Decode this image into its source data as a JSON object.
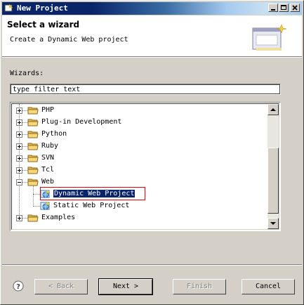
{
  "window": {
    "title": "New Project",
    "colors": {
      "titlebar": "#0a246a",
      "face": "#d4d0c8",
      "selection": "#0a246a",
      "highlight_box": "#e00000"
    }
  },
  "header": {
    "title": "Select a wizard",
    "description": "Create a Dynamic Web project",
    "banner_icon": "wizard-banner-icon"
  },
  "wizards": {
    "label": "Wizards:",
    "filter_value": "type filter text"
  },
  "tree": {
    "items": [
      {
        "label": "PHP",
        "expanded": false
      },
      {
        "label": "Plug-in Development",
        "expanded": false
      },
      {
        "label": "Python",
        "expanded": false
      },
      {
        "label": "Ruby",
        "expanded": false
      },
      {
        "label": "SVN",
        "expanded": false
      },
      {
        "label": "Tcl",
        "expanded": false
      },
      {
        "label": "Web",
        "expanded": true
      },
      {
        "label": "Dynamic Web Project",
        "child": true,
        "selected": true
      },
      {
        "label": "Static Web Project",
        "child": true
      },
      {
        "label": "Examples",
        "expanded": false
      }
    ]
  },
  "buttons": {
    "back": "< Back",
    "next": "Next >",
    "finish": "Finish",
    "cancel": "Cancel"
  }
}
